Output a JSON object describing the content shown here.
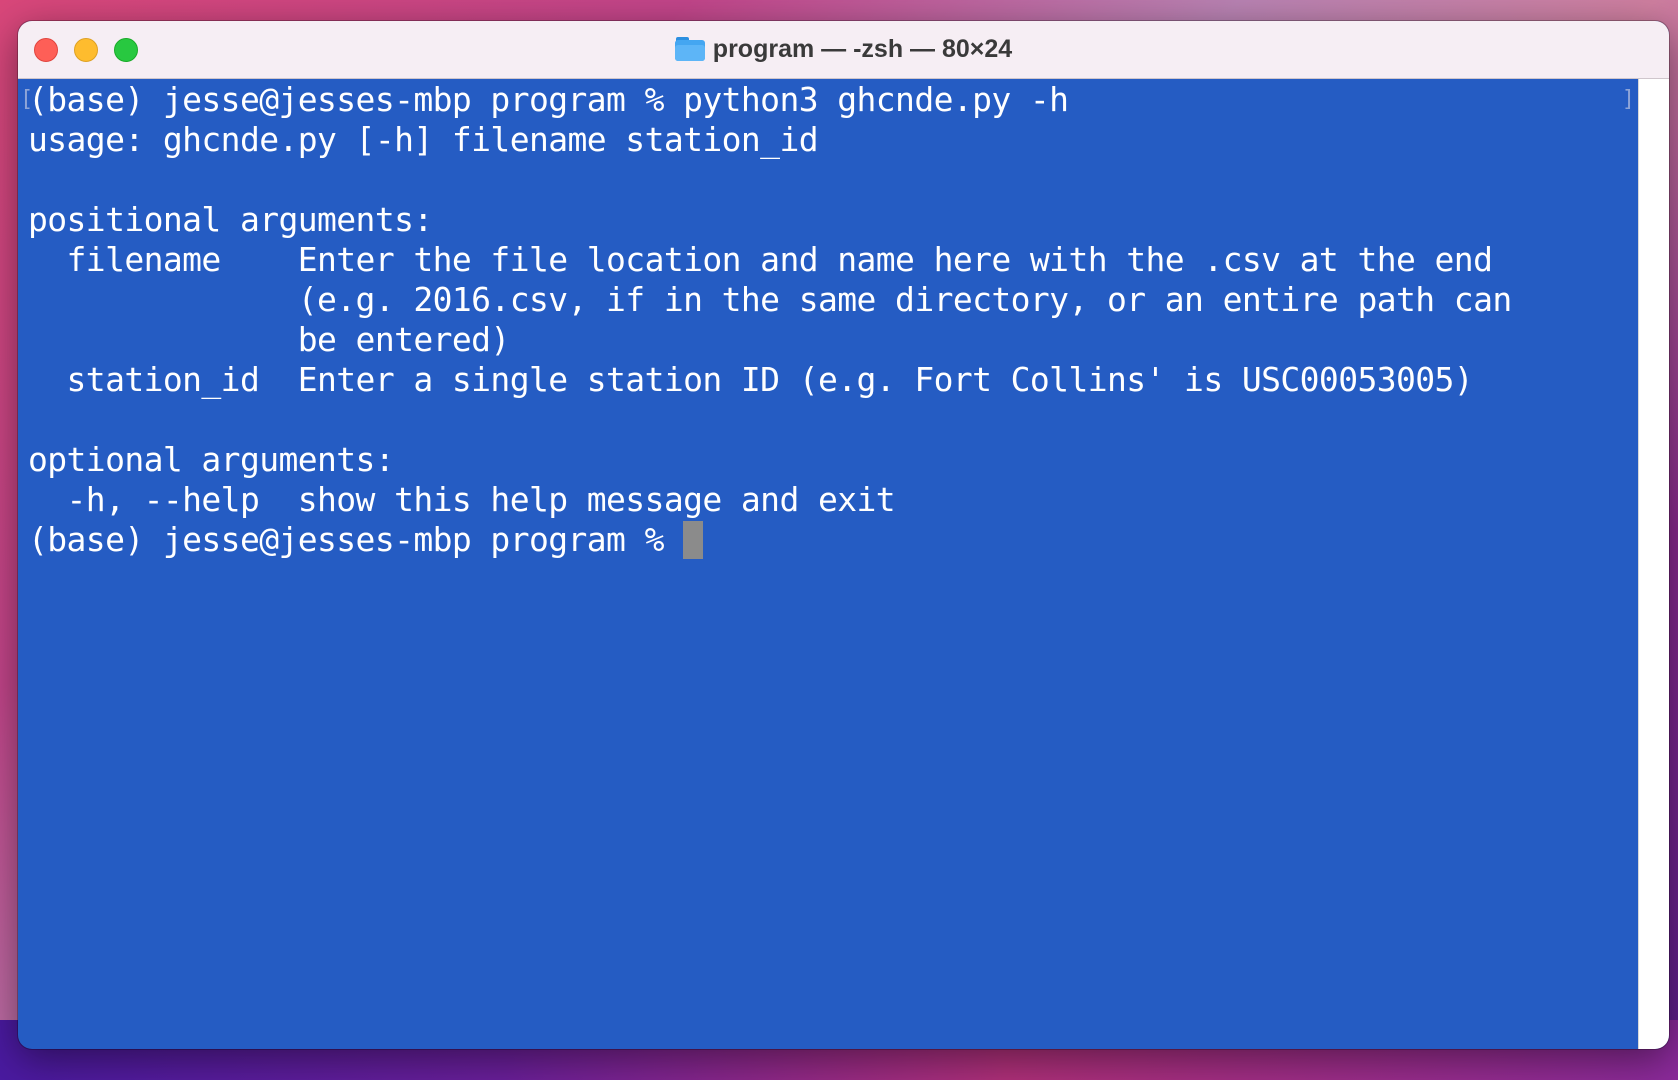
{
  "window": {
    "title": "program — -zsh — 80×24",
    "folder_icon": "folder-icon",
    "buttons": [
      "close",
      "minimize",
      "zoom"
    ]
  },
  "terminal": {
    "background_color": "#255cc3",
    "text_color": "#ffffff",
    "lines": [
      "(base) jesse@jesses-mbp program % python3 ghcnde.py -h",
      "usage: ghcnde.py [-h] filename station_id",
      "",
      "positional arguments:",
      "  filename    Enter the file location and name here with the .csv at the end",
      "              (e.g. 2016.csv, if in the same directory, or an entire path can",
      "              be entered)",
      "  station_id  Enter a single station ID (e.g. Fort Collins' is USC00053005)",
      "",
      "optional arguments:",
      "  -h, --help  show this help message and exit"
    ],
    "prompt": "(base) jesse@jesses-mbp program % "
  }
}
